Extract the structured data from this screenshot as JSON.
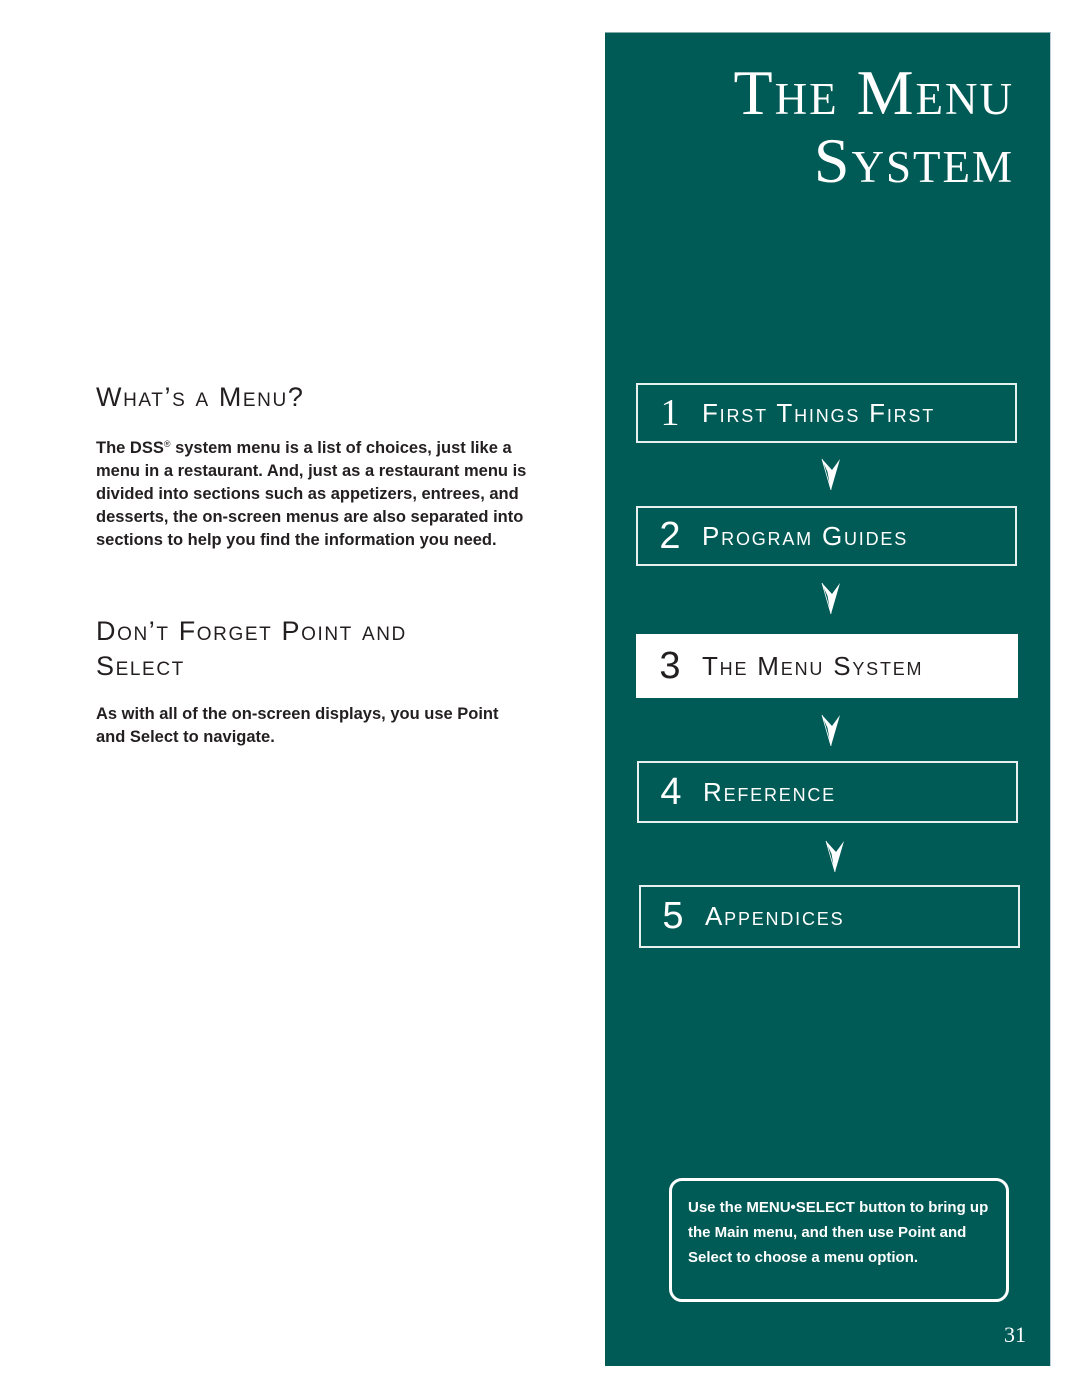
{
  "left": {
    "section1": {
      "heading": "What’s a Menu?",
      "body_pre": "The DSS",
      "body_sup": "®",
      "body_post": " system menu is a list of choices, just like a menu in a restaurant. And, just as a restaurant menu is divided into sections such as appetizers, entrees, and desserts, the on-screen menus are also separated into sections to help you find the information you need."
    },
    "section2": {
      "heading_line1": "Don’t Forget Point and",
      "heading_line2": "Select",
      "body": "As with all of the on-screen displays, you use Point and Select to navigate."
    }
  },
  "panel": {
    "title_line1": "The Menu",
    "title_line2": "System",
    "chapters": [
      {
        "number": "1",
        "label": "First Things First",
        "active": false
      },
      {
        "number": "2",
        "label": "Program Guides",
        "active": false
      },
      {
        "number": "3",
        "label": "The Menu System",
        "active": true
      },
      {
        "number": "4",
        "label": "Reference",
        "active": false
      },
      {
        "number": "5",
        "label": "Appendices",
        "active": false
      }
    ],
    "arrow_icon": "down-arrowhead-icon",
    "tip": {
      "pre": "Use the ",
      "highlight": "MENU•SELECT",
      "post": " button to bring up the Main menu, and then use Point and Select to choose a menu option."
    },
    "page_number": "31"
  },
  "colors": {
    "panel_bg": "#005a55",
    "text_dark": "#231f20",
    "panel_text": "#ffffff"
  }
}
